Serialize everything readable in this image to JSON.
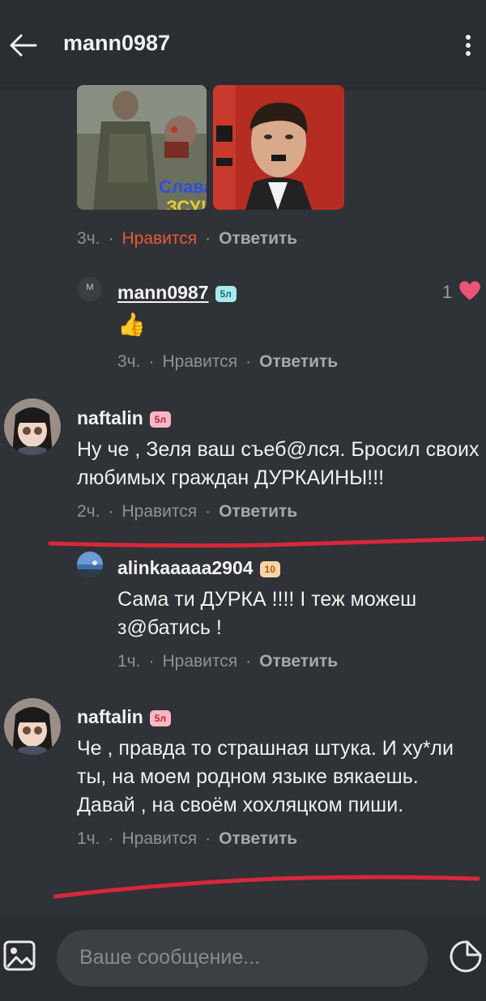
{
  "header": {
    "title": "mann0987",
    "back_icon": "arrow-left-icon",
    "menu_icon": "more-vertical-icon"
  },
  "post": {
    "images": [
      {
        "name": "soldier-image",
        "caption_line1": "Слава",
        "caption_line2": "ЗСУ!"
      },
      {
        "name": "portrait-image"
      }
    ],
    "time": "3ч.",
    "like_label": "Нравится",
    "reply_label": "Ответить",
    "like_color": "#e85a3a"
  },
  "comments": [
    {
      "avatar_letter": "M",
      "username": "mann0987",
      "badge": "5л",
      "text": "👍",
      "time": "3ч.",
      "like_label": "Нравится",
      "reply_label": "Ответить",
      "like_count": "1",
      "heart_color": "#ec5477"
    },
    {
      "username": "naftalin",
      "badge": "5л",
      "text": "Ну че , Зеля ваш съеб@лся. Бросил своих любимых граждан ДУРКАИНЫ!!!",
      "time": "2ч.",
      "like_label": "Нравится",
      "reply_label": "Ответить"
    },
    {
      "username": "alinkaaaaa2904",
      "badge": "10",
      "text": "Сама ти ДУРКА !!!! І теж можеш з@батись !",
      "time": "1ч.",
      "like_label": "Нравится",
      "reply_label": "Ответить"
    },
    {
      "username": "naftalin",
      "badge": "5л",
      "text": "Че , правда то страшная штука. И ху*ли ты, на моем родном языке вякаешь. Давай , на своём хохляцком пиши.",
      "time": "1ч.",
      "like_label": "Нравится",
      "reply_label": "Ответить"
    }
  ],
  "composer": {
    "placeholder": "Ваше сообщение...",
    "image_icon": "image-icon",
    "sticker_icon": "sticker-icon"
  },
  "annotation_color": "#d6283a"
}
